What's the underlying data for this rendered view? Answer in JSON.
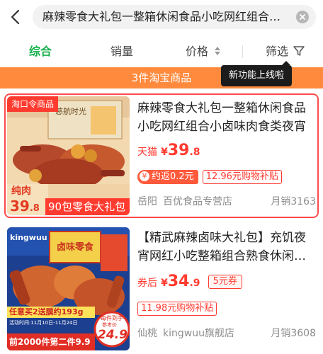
{
  "search": {
    "query": "麻辣零食大礼包一整箱休闲食品小吃网红组合小卤味肉食类夜宵"
  },
  "tabs": [
    {
      "label": "综合",
      "active": true
    },
    {
      "label": "销量",
      "active": false
    },
    {
      "label": "价格",
      "active": false
    },
    {
      "label": "筛选",
      "active": false
    }
  ],
  "banner": {
    "text": "3件淘宝商品",
    "tooltip": "新功能上线啦"
  },
  "products": [
    {
      "corner_tag": "淘口令商品",
      "image_caption_small": "纯肉",
      "image_price_int": "39",
      "image_price_dec": ".8",
      "image_slogan": "90包零食大礼包",
      "title": "麻辣零食大礼包一整箱休闲食品小吃网红组合小卤味肉食类夜宵",
      "price_prefix": "天猫",
      "price_yen": "¥",
      "price_int": "39",
      "price_dec": ".8",
      "rebate": "约返0.2元",
      "subsidy": "12.96元购物补贴",
      "location": "岳阳",
      "shop": "百优食品专营店",
      "sales": "月销3163",
      "image_box_text": "慈航时光"
    },
    {
      "brand_logo": "kingwuu",
      "image_caption": "任意买2送膜约193g",
      "image_date": "活动时间:11月10日-11月24日",
      "image_bottom": "前2000件第二件9.9",
      "image_badge_top": "每件到手",
      "image_badge_mid": "参考价",
      "image_badge_price": "24.9",
      "image_box_text": "卤味零食",
      "title": "【精武麻辣卤味大礼包】充饥夜宵网红小吃整箱组合熟食休闲零食",
      "price_prefix": "券后",
      "price_yen": "¥",
      "price_int": "34",
      "price_dec": ".9",
      "coupon": "5元券",
      "subsidy": "11.98元购物补贴",
      "location": "仙桃",
      "shop": "kingwuu旗舰店",
      "sales": "月销3608"
    }
  ],
  "colors": {
    "accent_green": "#16b04a",
    "banner_orange": "#ff8a3d",
    "price_red": "#ff3b30"
  }
}
